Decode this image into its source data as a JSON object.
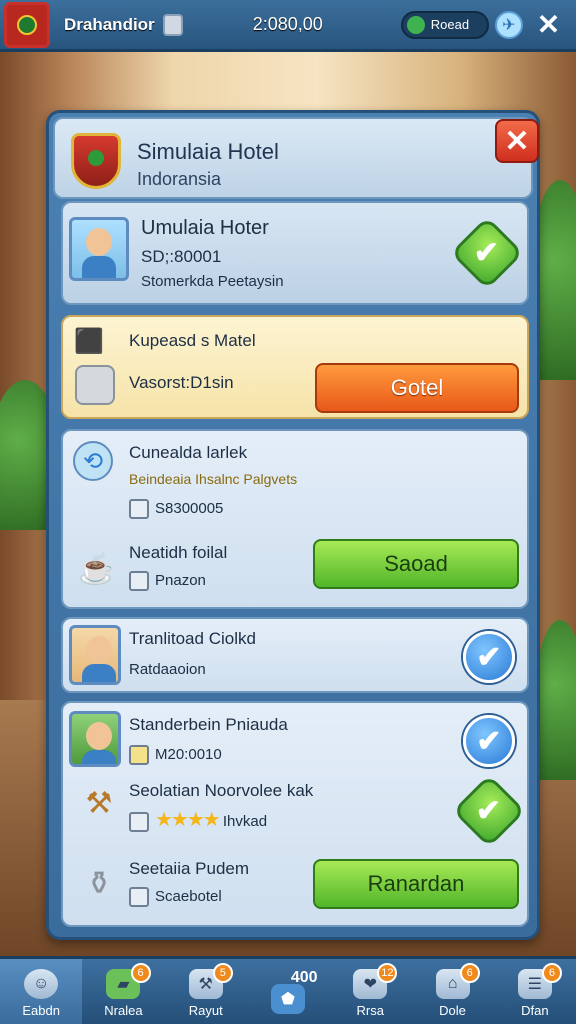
{
  "topbar": {
    "player_name": "Drahandior",
    "money": "2:080,00",
    "pill_label": "Roead"
  },
  "header": {
    "title": "Simulaia Hotel",
    "subtitle": "Indoransia"
  },
  "profile": {
    "name": "Umulaia Hoter",
    "line2": "SD;:80001",
    "line3": "Stomerkda Peetaysin"
  },
  "offer": {
    "title": "Kupeasd s Matel",
    "subtitle": "Vasorst:D1sin",
    "button": "Gotel"
  },
  "card_a": {
    "title": "Cunealda larlek",
    "tag": "Beindeaia Ihsalnc Palgvets",
    "value": "S8300005",
    "item_title": "Neatidh foilal",
    "item_sub": "Pnazon",
    "button": "Saoad"
  },
  "card_b": {
    "title": "Tranlitoad Ciolkd",
    "sub": "Ratdaaoion"
  },
  "card_c": {
    "row1_title": "Standerbein Pniauda",
    "row1_sub": "M20:0010",
    "row2_title": "Seolatian Noorvolee kak",
    "row2_sub": "Ihvkad",
    "row3_title": "Seetaiia Pudem",
    "row3_sub": "Scaebotel",
    "button": "Ranardan"
  },
  "nav": [
    {
      "label": "Eabdn",
      "badge": ""
    },
    {
      "label": "Nralea",
      "badge": "6"
    },
    {
      "label": "Rayut",
      "badge": "5"
    },
    {
      "label": "",
      "badge": "",
      "extra": "400"
    },
    {
      "label": "Rrsa",
      "badge": "12"
    },
    {
      "label": "Dole",
      "badge": "6"
    },
    {
      "label": "Dfan",
      "badge": "6"
    }
  ],
  "colors": {
    "panel": "#4b80b3",
    "orange_button": "#e8591a",
    "green_button": "#52b52a",
    "close_red": "#cf2f1e"
  }
}
